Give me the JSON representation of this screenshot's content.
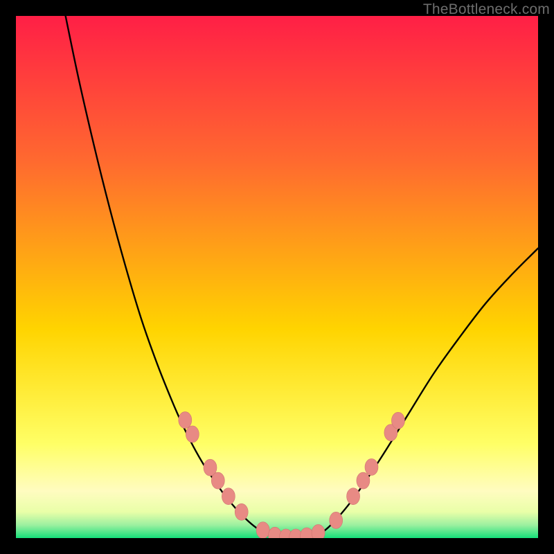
{
  "watermark": "TheBottleneck.com",
  "colors": {
    "gradient_top": "#ff1f46",
    "gradient_mid1": "#ff6a2f",
    "gradient_mid2": "#ffd400",
    "gradient_mid3": "#ffff66",
    "gradient_mid4": "#fffcc0",
    "gradient_bottom": "#15e07a",
    "curve": "#000000",
    "marker_fill": "#e88a84",
    "marker_stroke": "#d07571"
  },
  "chart_data": {
    "type": "line",
    "title": "",
    "xlabel": "",
    "ylabel": "",
    "xlim": [
      0,
      100
    ],
    "ylim": [
      0,
      100
    ],
    "series": [
      {
        "name": "left_branch",
        "x": [
          9.5,
          12,
          15,
          18,
          21,
          24,
          27,
          30,
          32,
          34,
          36,
          38,
          40,
          42,
          44,
          46,
          48
        ],
        "y": [
          100,
          88,
          75,
          63,
          52,
          42,
          33.5,
          26,
          21.5,
          17.5,
          14,
          11,
          8.2,
          5.8,
          3.7,
          2.0,
          0.8
        ]
      },
      {
        "name": "valley",
        "x": [
          48,
          50,
          52,
          54,
          56,
          58
        ],
        "y": [
          0.8,
          0.2,
          0.0,
          0.0,
          0.2,
          0.8
        ]
      },
      {
        "name": "right_branch",
        "x": [
          58,
          60,
          63,
          66,
          70,
          75,
          80,
          85,
          90,
          95,
          100
        ],
        "y": [
          0.8,
          2.2,
          5.5,
          9.5,
          15.5,
          23.5,
          31.5,
          38.5,
          45,
          50.5,
          55.5
        ]
      }
    ],
    "markers": {
      "name": "highlight_points",
      "points": [
        {
          "x": 32.4,
          "y": 22.6
        },
        {
          "x": 33.8,
          "y": 19.9
        },
        {
          "x": 37.2,
          "y": 13.5
        },
        {
          "x": 38.7,
          "y": 11.0
        },
        {
          "x": 40.7,
          "y": 8.0
        },
        {
          "x": 43.2,
          "y": 5.0
        },
        {
          "x": 47.3,
          "y": 1.5
        },
        {
          "x": 49.6,
          "y": 0.5
        },
        {
          "x": 51.7,
          "y": 0.15
        },
        {
          "x": 53.6,
          "y": 0.15
        },
        {
          "x": 55.7,
          "y": 0.4
        },
        {
          "x": 57.9,
          "y": 1.0
        },
        {
          "x": 61.3,
          "y": 3.4
        },
        {
          "x": 64.6,
          "y": 8.0
        },
        {
          "x": 66.5,
          "y": 11.0
        },
        {
          "x": 68.1,
          "y": 13.6
        },
        {
          "x": 71.8,
          "y": 20.2
        },
        {
          "x": 73.2,
          "y": 22.5
        }
      ]
    }
  }
}
